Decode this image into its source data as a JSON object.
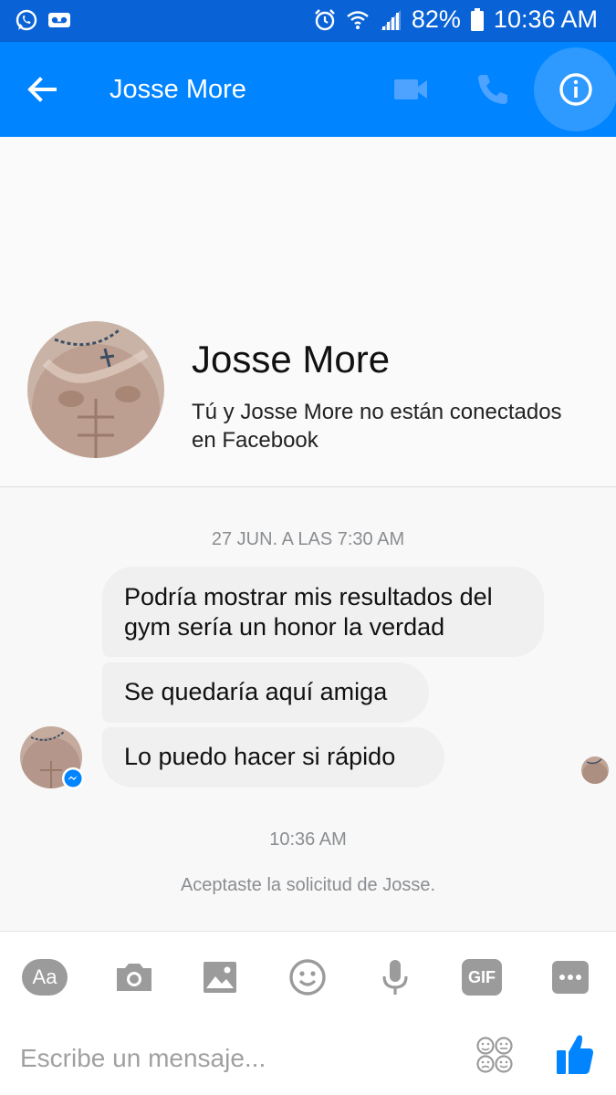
{
  "status_bar": {
    "battery": "82%",
    "time": "10:36 AM"
  },
  "header": {
    "title": "Josse More"
  },
  "profile": {
    "name": "Josse More",
    "subtitle": "Tú y Josse More no están conectados en Facebook"
  },
  "conversation": {
    "timestamp_1": "27 JUN. A LAS 7:30 AM",
    "messages": [
      {
        "text": "Podría mostrar mis resultados del gym sería un honor la verdad"
      },
      {
        "text": "Se quedaría aquí amiga"
      },
      {
        "text": "Lo puedo hacer si rápido"
      }
    ],
    "timestamp_2": "10:36 AM",
    "system_note": "Aceptaste la solicitud de Josse."
  },
  "composer": {
    "aa_label": "Aa",
    "gif_label": "GIF",
    "placeholder": "Escribe un mensaje..."
  },
  "colors": {
    "status_bar": "#0a63d6",
    "app_bar": "#0084ff",
    "bubble": "#f1f0f0",
    "tool_gray": "#9b9b9b"
  },
  "icons": [
    "whatsapp-icon",
    "voicemail-icon",
    "alarm-icon",
    "wifi-icon",
    "signal-icon",
    "battery-icon",
    "back-arrow-icon",
    "video-call-icon",
    "phone-icon",
    "info-icon",
    "messenger-badge-icon",
    "camera-icon",
    "image-icon",
    "emoji-icon",
    "microphone-icon",
    "more-icon",
    "stickers-icon",
    "thumbs-up-icon"
  ]
}
